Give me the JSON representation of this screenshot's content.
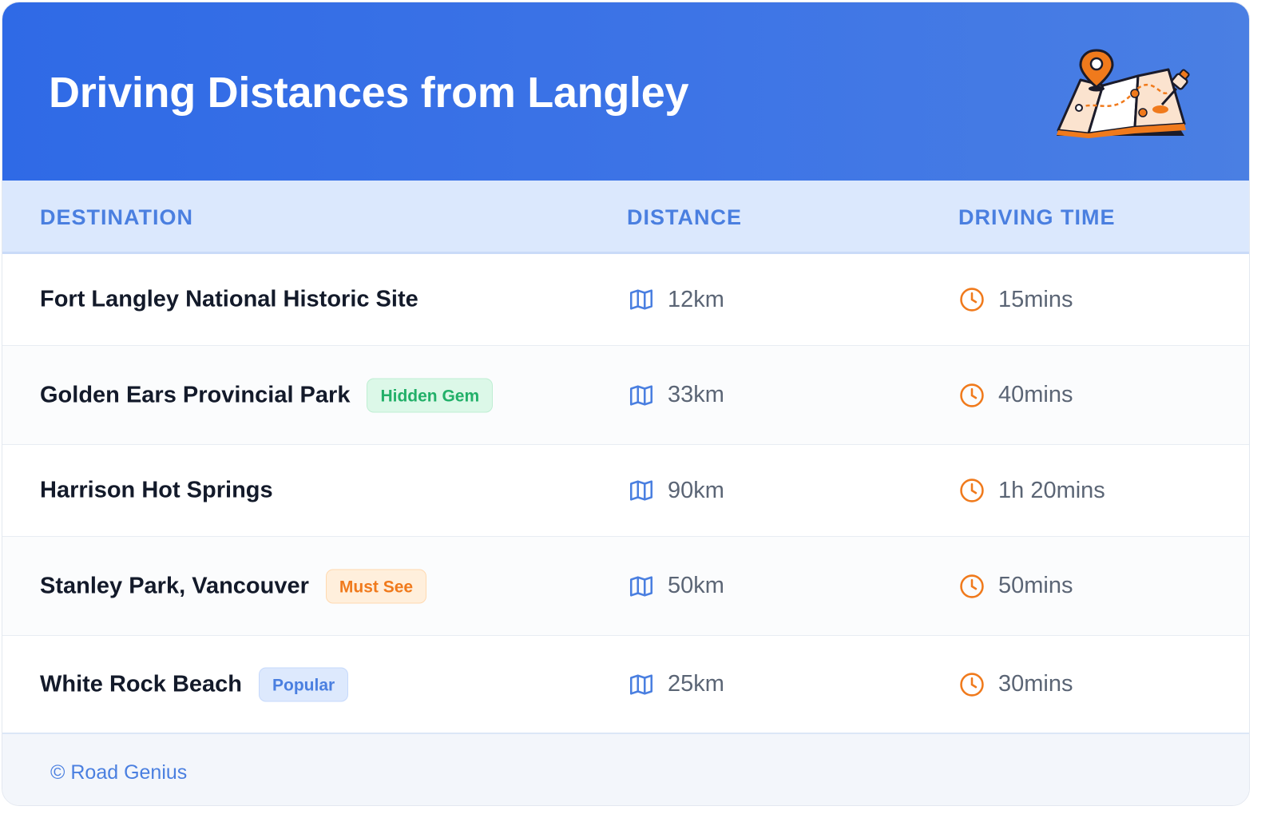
{
  "header": {
    "title": "Driving Distances from Langley"
  },
  "table": {
    "columns": [
      "DESTINATION",
      "DISTANCE",
      "DRIVING TIME"
    ],
    "rows": [
      {
        "destination": "Fort Langley National Historic Site",
        "badge": "",
        "badge_color": "",
        "distance": "12km",
        "time": "15mins"
      },
      {
        "destination": "Golden Ears Provincial Park",
        "badge": "Hidden Gem",
        "badge_color": "green",
        "distance": "33km",
        "time": "40mins"
      },
      {
        "destination": "Harrison Hot Springs",
        "badge": "",
        "badge_color": "",
        "distance": "90km",
        "time": "1h 20mins"
      },
      {
        "destination": "Stanley Park, Vancouver",
        "badge": "Must See",
        "badge_color": "orange",
        "distance": "50km",
        "time": "50mins"
      },
      {
        "destination": "White Rock Beach",
        "badge": "Popular",
        "badge_color": "blue",
        "distance": "25km",
        "time": "30mins"
      }
    ]
  },
  "footer": {
    "copyright": "© Road Genius"
  },
  "colors": {
    "header_blue": "#2f6ae6",
    "accent_blue": "#4a7fe0",
    "orange": "#f07a1c",
    "green": "#22b069"
  },
  "icons": {
    "distance": "map-icon",
    "time": "clock-icon",
    "header_illustration": "map-pin-illustration"
  }
}
